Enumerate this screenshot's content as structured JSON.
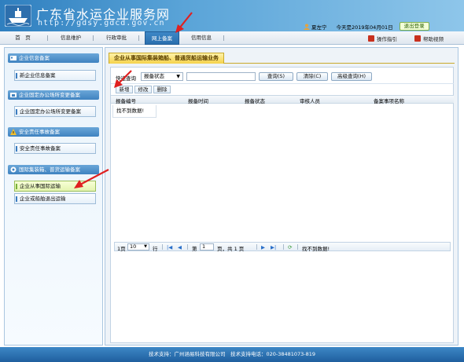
{
  "header": {
    "title": "广东省水运企业服务网",
    "url": "http://gdsy.gdcd.gov.cn",
    "user": "夏左宁",
    "today": "今天是2019年04月01日",
    "logout_label": "退出登录"
  },
  "nav": {
    "items": [
      {
        "label": "首　页"
      },
      {
        "label": "信息维护"
      },
      {
        "label": "行政审批"
      },
      {
        "label": "网上备案"
      },
      {
        "label": "信用信息"
      }
    ],
    "active": "网上备案",
    "guide_label": "操作指引",
    "help_label": "帮助视频"
  },
  "sidebar": {
    "sections": [
      {
        "title": "企业信息备案",
        "items": [
          {
            "label": "新企业信息备案"
          }
        ]
      },
      {
        "title": "企业固定办公场所变更备案",
        "items": [
          {
            "label": "企业固定办公场所变更备案"
          }
        ]
      },
      {
        "title": "安全责任事故备案",
        "items": [
          {
            "label": "安全责任事故备案"
          }
        ]
      },
      {
        "title": "国际集装箱、普货运输备案",
        "items": [
          {
            "label": "企业从事国际运输"
          },
          {
            "label": "企业或船舶退出运输"
          }
        ]
      }
    ],
    "active_item": "企业从事国际运输"
  },
  "main": {
    "panel_title": "企业从事国际集装箱船、普通货船运输业务",
    "search": {
      "label": "快速查询",
      "select_value": "报备状态",
      "input_value": "",
      "query_label": "查询(S)",
      "clear_label": "清除(C)",
      "advanced_label": "高级查询(H)"
    },
    "toolbar": {
      "add_label": "新增",
      "edit_label": "修改",
      "delete_label": "删除"
    },
    "table": {
      "columns": [
        "报备编号",
        "报备时间",
        "报备状态",
        "审核人员",
        "备案事项名称"
      ],
      "empty_text": "找不到数据!"
    },
    "pager": {
      "page_size_prefix": "1页",
      "page_size": "10",
      "page_size_suffix": "行",
      "page_label": "第",
      "page_value": "1",
      "page_suffix": "页，共 1 页",
      "status": "找不到数据!"
    }
  },
  "footer": {
    "text": "技术支持：广州涵易科技有限公司　技术支持电话：020-38481073-819"
  },
  "colors": {
    "header_blue": "#3f8ccb",
    "nav_active": "#2a6fae",
    "panel_title_yellow": "#f5d24a",
    "active_item_green": "#e4f4b0",
    "annotation_red": "#e02020"
  }
}
